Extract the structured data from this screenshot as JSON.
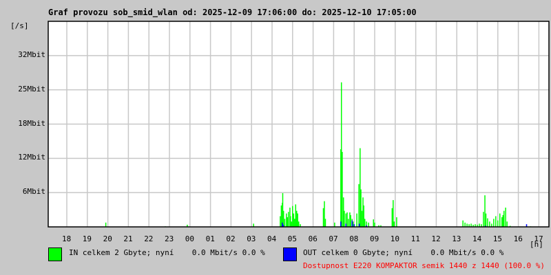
{
  "title": "Graf provozu sob_smid_wlan od: 2025-12-09 17:06:00 do: 2025-12-10 17:05:00",
  "chart_data": {
    "type": "line",
    "title": "Graf provozu sob_smid_wlan od: 2025-12-09 17:06:00 do: 2025-12-10 17:05:00",
    "ylabel": "[/s]",
    "xlabel": "[h]",
    "ylim": [
      0,
      38.4
    ],
    "xlim_hours_since_17": [
      0.1,
      24.08
    ],
    "y_ticks": [
      {
        "v": 6.4,
        "label": "6Mbit"
      },
      {
        "v": 12.8,
        "label": "12Mbit"
      },
      {
        "v": 19.2,
        "label": "18Mbit"
      },
      {
        "v": 25.6,
        "label": "25Mbit"
      },
      {
        "v": 32,
        "label": "32Mbit"
      }
    ],
    "x_ticks": [
      "18",
      "19",
      "20",
      "21",
      "22",
      "23",
      "00",
      "01",
      "02",
      "03",
      "04",
      "05",
      "06",
      "07",
      "08",
      "09",
      "10",
      "11",
      "12",
      "13",
      "14",
      "15",
      "16",
      "17"
    ],
    "grid": true,
    "series": [
      {
        "name": "IN",
        "color": "#00ff00",
        "unit": "Mbit/s",
        "points": [
          [
            2.9,
            0.8
          ],
          [
            5.8,
            0.1
          ],
          [
            6.87,
            0.4
          ],
          [
            10.1,
            0.6
          ],
          [
            11.4,
            2.0
          ],
          [
            11.45,
            4.0
          ],
          [
            11.5,
            4.5
          ],
          [
            11.52,
            6.3
          ],
          [
            11.56,
            3.0
          ],
          [
            11.62,
            1.5
          ],
          [
            11.7,
            2.5
          ],
          [
            11.75,
            1.8
          ],
          [
            11.8,
            2.8
          ],
          [
            11.87,
            3.6
          ],
          [
            11.9,
            2.0
          ],
          [
            11.95,
            1.0
          ],
          [
            12.0,
            3.9
          ],
          [
            12.05,
            2.5
          ],
          [
            12.1,
            1.5
          ],
          [
            12.15,
            4.2
          ],
          [
            12.2,
            3.0
          ],
          [
            12.25,
            2.5
          ],
          [
            12.3,
            1.0
          ],
          [
            12.38,
            0.5
          ],
          [
            13.5,
            3.5
          ],
          [
            13.55,
            4.8
          ],
          [
            13.6,
            1.5
          ],
          [
            14.05,
            0.8
          ],
          [
            14.35,
            14.5
          ],
          [
            14.38,
            27.0
          ],
          [
            14.42,
            14.0
          ],
          [
            14.48,
            5.5
          ],
          [
            14.52,
            3.0
          ],
          [
            14.6,
            2.5
          ],
          [
            14.66,
            2.7
          ],
          [
            14.72,
            1.5
          ],
          [
            14.79,
            2.7
          ],
          [
            14.83,
            2.2
          ],
          [
            14.9,
            1.5
          ],
          [
            14.95,
            1.0
          ],
          [
            15.13,
            2.5
          ],
          [
            15.23,
            8.0
          ],
          [
            15.29,
            14.7
          ],
          [
            15.33,
            7.0
          ],
          [
            15.38,
            3.0
          ],
          [
            15.43,
            5.5
          ],
          [
            15.47,
            4.0
          ],
          [
            15.52,
            1.5
          ],
          [
            15.6,
            1.0
          ],
          [
            15.7,
            0.8
          ],
          [
            15.94,
            1.4
          ],
          [
            16.0,
            0.8
          ],
          [
            16.2,
            0.3
          ],
          [
            16.3,
            0.3
          ],
          [
            16.85,
            3.5
          ],
          [
            16.9,
            5.0
          ],
          [
            16.95,
            1.0
          ],
          [
            17.07,
            1.8
          ],
          [
            20.3,
            1.2
          ],
          [
            20.4,
            0.8
          ],
          [
            20.5,
            0.6
          ],
          [
            20.6,
            0.5
          ],
          [
            20.7,
            0.6
          ],
          [
            20.8,
            0.4
          ],
          [
            20.9,
            0.5
          ],
          [
            21.0,
            0.4
          ],
          [
            21.1,
            0.6
          ],
          [
            21.2,
            0.5
          ],
          [
            21.3,
            2.8
          ],
          [
            21.37,
            5.9
          ],
          [
            21.42,
            2.5
          ],
          [
            21.5,
            1.6
          ],
          [
            21.6,
            1.0
          ],
          [
            21.7,
            0.6
          ],
          [
            21.8,
            1.5
          ],
          [
            21.9,
            2.0
          ],
          [
            22.0,
            1.2
          ],
          [
            22.1,
            2.5
          ],
          [
            22.2,
            1.8
          ],
          [
            22.25,
            2.2
          ],
          [
            22.3,
            3.0
          ],
          [
            22.38,
            3.6
          ],
          [
            22.45,
            1.0
          ],
          [
            22.6,
            0.2
          ],
          [
            23.4,
            0.2
          ],
          [
            23.6,
            0.1
          ]
        ]
      },
      {
        "name": "OUT",
        "color": "#0000ff",
        "unit": "Mbit/s",
        "points": [
          [
            11.5,
            0.8
          ],
          [
            11.55,
            0.4
          ],
          [
            14.35,
            1.0
          ],
          [
            14.6,
            0.6
          ],
          [
            14.9,
            1.2
          ],
          [
            15.0,
            0.5
          ],
          [
            15.25,
            0.6
          ],
          [
            15.6,
            0.3
          ],
          [
            21.4,
            0.2
          ],
          [
            23.4,
            0.5
          ]
        ]
      }
    ]
  },
  "legend": {
    "in_text": "IN celkem 2 Gbyte; nyní    0.0 Mbit/s 0.0 %",
    "out_text": "OUT celkem 0 Gbyte; nyní    0.0 Mbit/s 0.0 %",
    "availability": "Dostupnost E220 KOMPAKTOR semik 1440 z 1440 (100.0 %)",
    "in_color": "#00ff00",
    "out_color": "#0000ff",
    "availability_color": "#ff0000"
  }
}
